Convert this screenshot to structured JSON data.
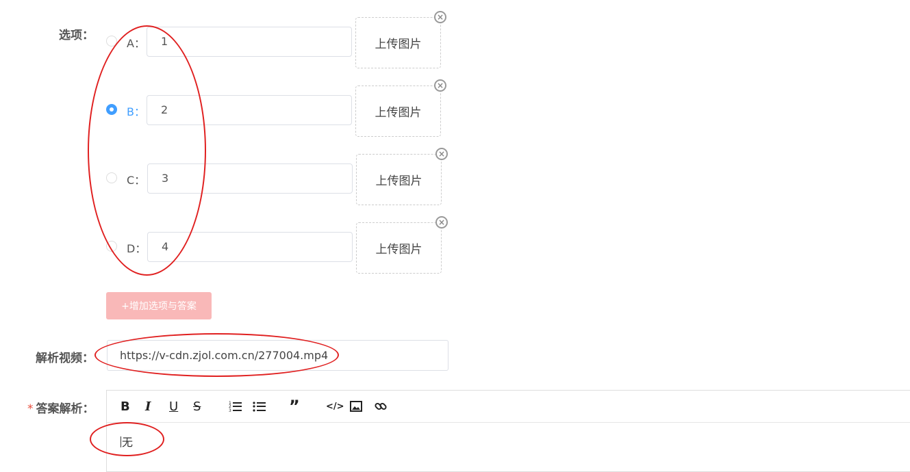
{
  "form": {
    "options_label": "选项：",
    "options": [
      {
        "letter": "A：",
        "value": "1",
        "upload_label": "上传图片",
        "checked": false
      },
      {
        "letter": "B：",
        "value": "2",
        "upload_label": "上传图片",
        "checked": true
      },
      {
        "letter": "C：",
        "value": "3",
        "upload_label": "上传图片",
        "checked": false
      },
      {
        "letter": "D：",
        "value": "4",
        "upload_label": "上传图片",
        "checked": false
      }
    ],
    "add_option_button": "+增加选项与答案",
    "video_label": "解析视频：",
    "video_url": "https://v-cdn.zjol.com.cn/277004.mp4",
    "analysis_required_mark": "*",
    "analysis_label": "答案解析：",
    "analysis_content": "无"
  },
  "editor_toolbar": [
    {
      "name": "bold-icon",
      "glyph": "B"
    },
    {
      "name": "italic-icon",
      "glyph": "I"
    },
    {
      "name": "underline-icon",
      "glyph": "U"
    },
    {
      "name": "strikethrough-icon",
      "glyph": "S"
    },
    {
      "name": "ordered-list-icon",
      "glyph": "≡"
    },
    {
      "name": "bullet-list-icon",
      "glyph": "☰"
    },
    {
      "name": "quote-icon",
      "glyph": "❞"
    },
    {
      "name": "code-icon",
      "glyph": "</>"
    },
    {
      "name": "image-icon",
      "glyph": "▣"
    },
    {
      "name": "link-icon",
      "glyph": "🔗"
    }
  ],
  "colors": {
    "accent": "#409eff",
    "annotation": "#e02020",
    "add_button_bg": "#f9b8b8",
    "required": "#e74c3c"
  }
}
